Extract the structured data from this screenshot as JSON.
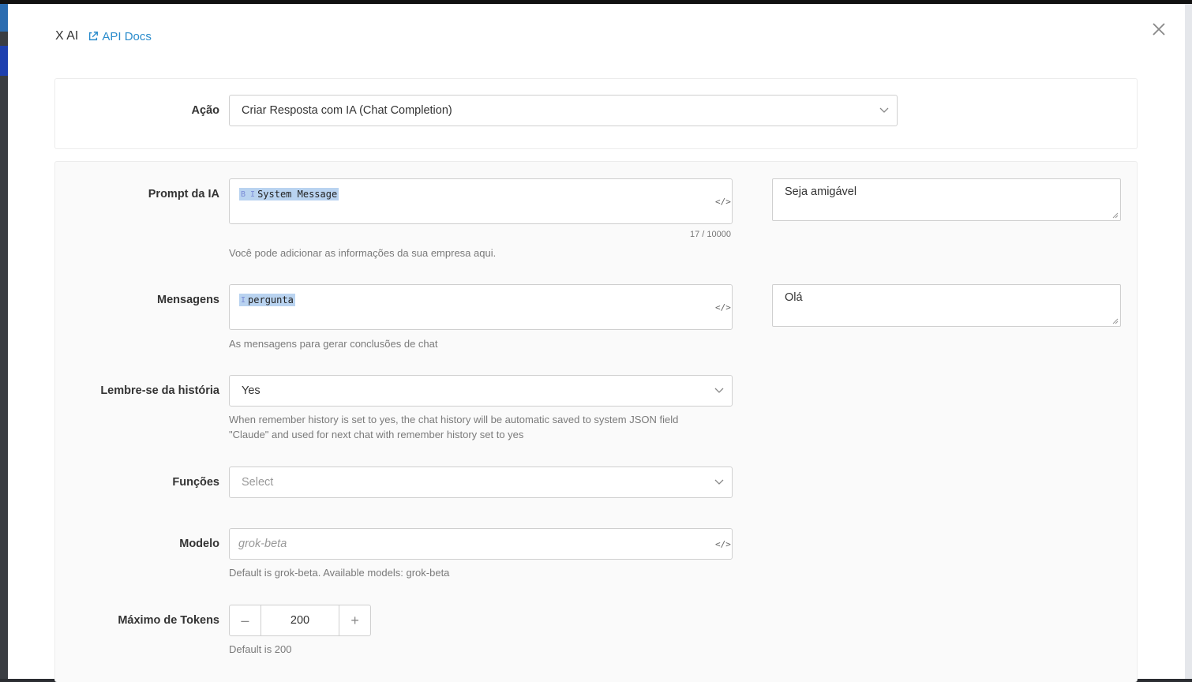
{
  "header": {
    "title": "X AI",
    "docs_link": "API Docs"
  },
  "action": {
    "label": "Ação",
    "value": "Criar Resposta com IA (Chat Completion)"
  },
  "prompt": {
    "label": "Prompt da IA",
    "chip_tags": "B I",
    "chip_text": "System Message",
    "counter": "17 / 10000",
    "help": "Você pode adicionar as informações da sua empresa aqui.",
    "side_value": "Seja amigável"
  },
  "messages": {
    "label": "Mensagens",
    "chip_tags": "I",
    "chip_text": "pergunta",
    "help": "As mensagens para gerar conclusões de chat",
    "side_value": "Olá"
  },
  "history": {
    "label": "Lembre-se da história",
    "value": "Yes",
    "help_line1": "When remember history is set to yes, the chat history will be automatic saved to system JSON field",
    "help_line2": "\"Claude\" and used for next chat with remember history set to yes"
  },
  "functions": {
    "label": "Funções",
    "placeholder": "Select"
  },
  "model": {
    "label": "Modelo",
    "placeholder": "grok-beta",
    "help": "Default is grok-beta. Available models: grok-beta"
  },
  "tokens": {
    "label": "Máximo de Tokens",
    "value": "200",
    "minus": "–",
    "plus": "+",
    "help": "Default is 200"
  },
  "colors": {
    "link": "#2b8ccc",
    "chip_bg": "#b9d3f0",
    "border": "#cfcfcf"
  }
}
